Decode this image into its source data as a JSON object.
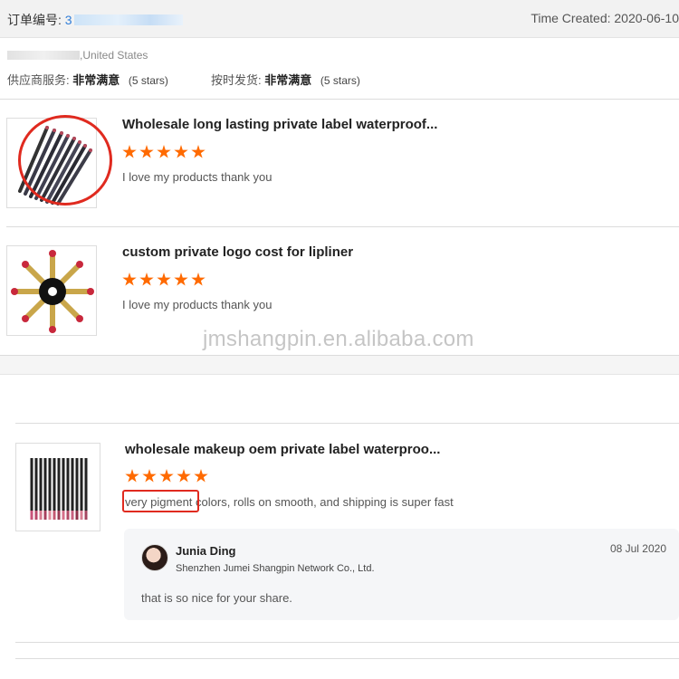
{
  "order": {
    "label": "订单编号:",
    "number_visible": "3",
    "time_created": "Time Created: 2020-06-10"
  },
  "buyer": {
    "country": ",United States"
  },
  "ratings": {
    "supplier_service_label": "供应商服务:",
    "supplier_service_value": "非常满意",
    "supplier_service_stars": "(5 stars)",
    "on_time_label": "按时发货:",
    "on_time_value": "非常满意",
    "on_time_stars": "(5 stars)"
  },
  "products": [
    {
      "title": "Wholesale long lasting private label waterproof...",
      "stars": 5,
      "review": "I love my products thank you"
    },
    {
      "title": "custom private logo cost for lipliner",
      "stars": 5,
      "review": "I love my products thank you"
    },
    {
      "title": "wholesale makeup oem private label waterproo...",
      "stars": 5,
      "review": "very pigment colors, rolls on smooth, and shipping is super fast"
    }
  ],
  "reply": {
    "name": "Junia Ding",
    "company": "Shenzhen Jumei Shangpin Network Co., Ltd.",
    "date": "08 Jul 2020",
    "text": "that is so nice for your share."
  },
  "watermark": "jmshangpin.en.alibaba.com",
  "colors": {
    "star": "#ff6a00",
    "highlight": "#e02a1f",
    "order_link": "#2f7dd8"
  }
}
